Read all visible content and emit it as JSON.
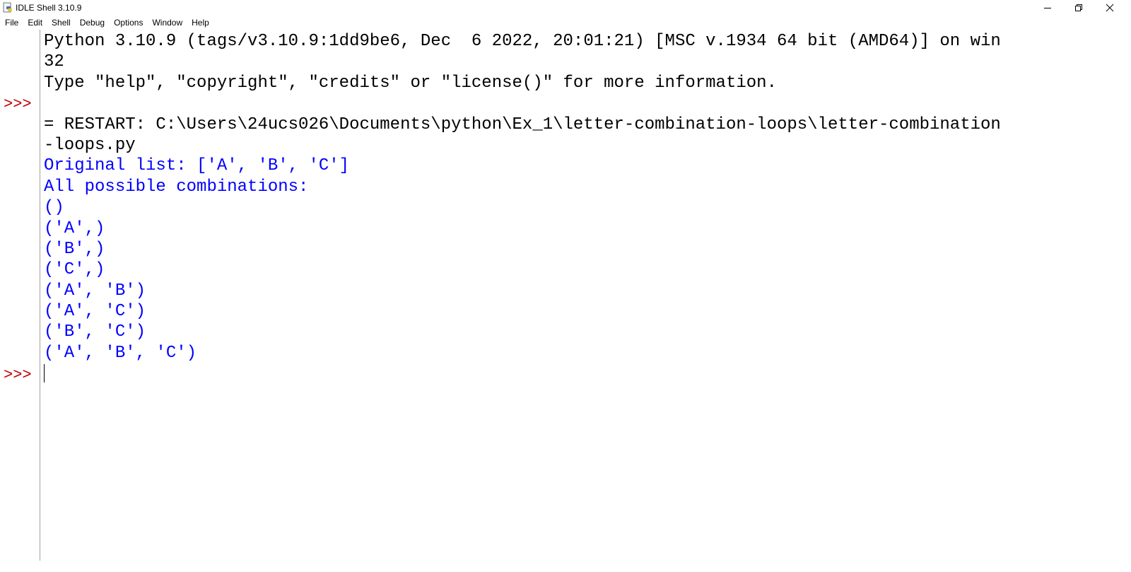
{
  "window": {
    "title": "IDLE Shell 3.10.9",
    "app_icon": "python-idle-icon"
  },
  "menu": {
    "items": [
      "File",
      "Edit",
      "Shell",
      "Debug",
      "Options",
      "Window",
      "Help"
    ]
  },
  "shell": {
    "prompt": ">>>",
    "lines": [
      {
        "kind": "normal",
        "text": "Python 3.10.9 (tags/v3.10.9:1dd9be6, Dec  6 2022, 20:01:21) [MSC v.1934 64 bit (AMD64)] on win"
      },
      {
        "kind": "normal",
        "text": "32"
      },
      {
        "kind": "normal",
        "text": "Type \"help\", \"copyright\", \"credits\" or \"license()\" for more information."
      },
      {
        "kind": "normal",
        "text": ""
      },
      {
        "kind": "normal",
        "text": "= RESTART: C:\\Users\\24ucs026\\Documents\\python\\Ex_1\\letter-combination-loops\\letter-combination"
      },
      {
        "kind": "normal",
        "text": "-loops.py"
      },
      {
        "kind": "stdout",
        "text": "Original list: ['A', 'B', 'C']"
      },
      {
        "kind": "stdout",
        "text": "All possible combinations:"
      },
      {
        "kind": "stdout",
        "text": "()"
      },
      {
        "kind": "stdout",
        "text": "('A',)"
      },
      {
        "kind": "stdout",
        "text": "('B',)"
      },
      {
        "kind": "stdout",
        "text": "('C',)"
      },
      {
        "kind": "stdout",
        "text": "('A', 'B')"
      },
      {
        "kind": "stdout",
        "text": "('A', 'C')"
      },
      {
        "kind": "stdout",
        "text": "('B', 'C')"
      },
      {
        "kind": "stdout",
        "text": "('A', 'B', 'C')"
      },
      {
        "kind": "input",
        "text": ""
      }
    ],
    "colors": {
      "prompt": "#c00000",
      "stdout": "#0000ff",
      "normal": "#000000"
    }
  }
}
